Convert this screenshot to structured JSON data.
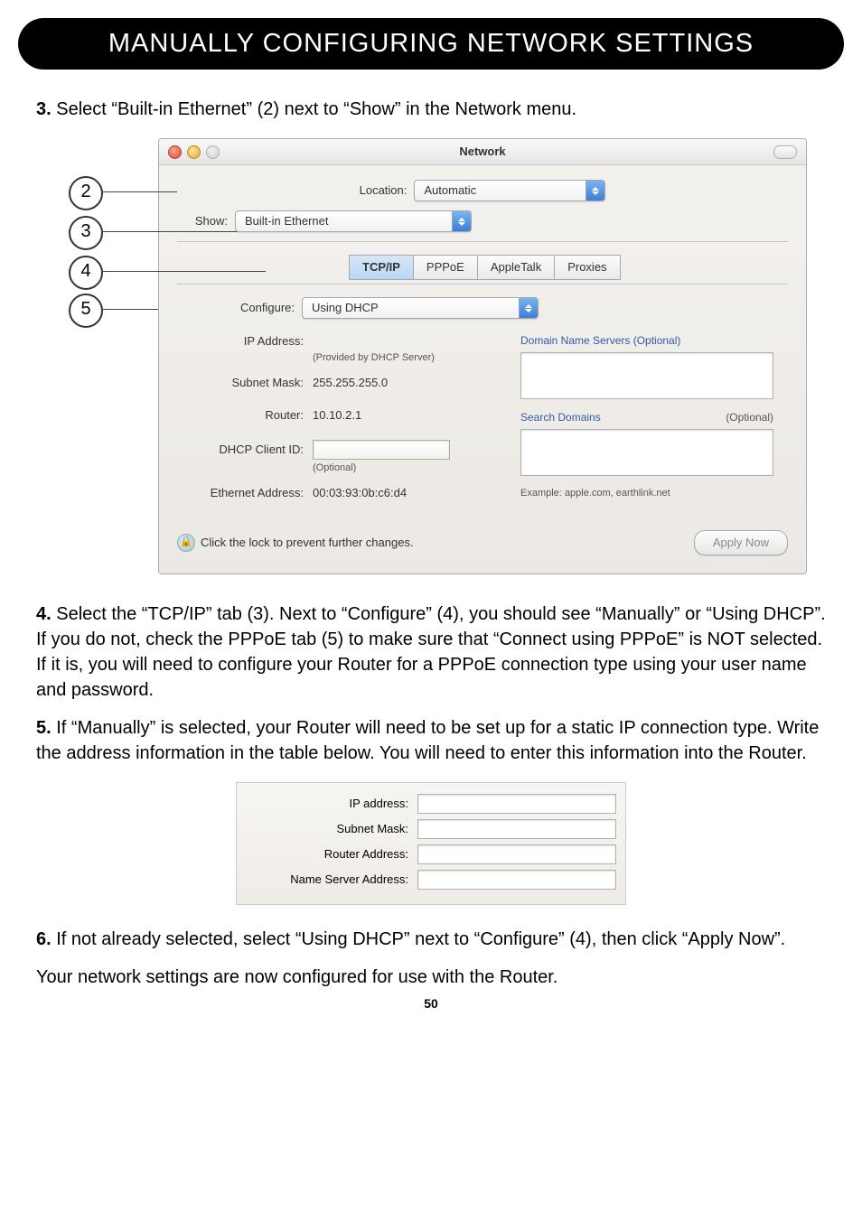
{
  "header": "MANUALLY CONFIGURING NETWORK SETTINGS",
  "steps": {
    "s3": "Select “Built-in Ethernet” (2) next to “Show” in the Network menu.",
    "s4": "Select the “TCP/IP” tab (3). Next to “Configure” (4), you should see “Manually” or “Using DHCP”. If you do not, check the PPPoE tab (5) to make sure that “Connect using PPPoE” is NOT selected. If it is, you will need to configure your Router for a PPPoE connection type using your user name and password.",
    "s5": "If “Manually” is selected, your Router will need to be set up for a static IP connection type. Write the address information in the table below. You will need to enter this information into the Router.",
    "s6": "If not already selected, select “Using DHCP” next to “Configure” (4), then click “Apply Now”.",
    "closing": "Your network settings are now configured for use with the Router."
  },
  "step_numbers": {
    "n3": "3.",
    "n4": "4.",
    "n5": "5.",
    "n6": "6."
  },
  "callouts": {
    "c2": "2",
    "c3": "3",
    "c4": "4",
    "c5": "5"
  },
  "win": {
    "title": "Network",
    "location_label": "Location:",
    "location_value": "Automatic",
    "show_label": "Show:",
    "show_value": "Built-in Ethernet",
    "tabs": {
      "tcpip": "TCP/IP",
      "pppoe": "PPPoE",
      "appletalk": "AppleTalk",
      "proxies": "Proxies"
    },
    "configure_label": "Configure:",
    "configure_value": "Using DHCP",
    "ip_label": "IP Address:",
    "ip_sub": "(Provided by DHCP Server)",
    "subnet_label": "Subnet Mask:",
    "subnet_value": "255.255.255.0",
    "router_label": "Router:",
    "router_value": "10.10.2.1",
    "dhcp_label": "DHCP Client ID:",
    "dhcp_sub": "(Optional)",
    "eth_label": "Ethernet Address:",
    "eth_value": "00:03:93:0b:c6:d4",
    "dns_head": "Domain Name Servers  (Optional)",
    "search_head": "Search Domains",
    "search_opt": "(Optional)",
    "example": "Example: apple.com, earthlink.net",
    "lock_text": "Click the lock to prevent further changes.",
    "apply": "Apply Now"
  },
  "smalltable": {
    "ip": "IP address:",
    "subnet": "Subnet Mask:",
    "router": "Router Address:",
    "ns": "Name Server Address:"
  },
  "page_number": "50"
}
